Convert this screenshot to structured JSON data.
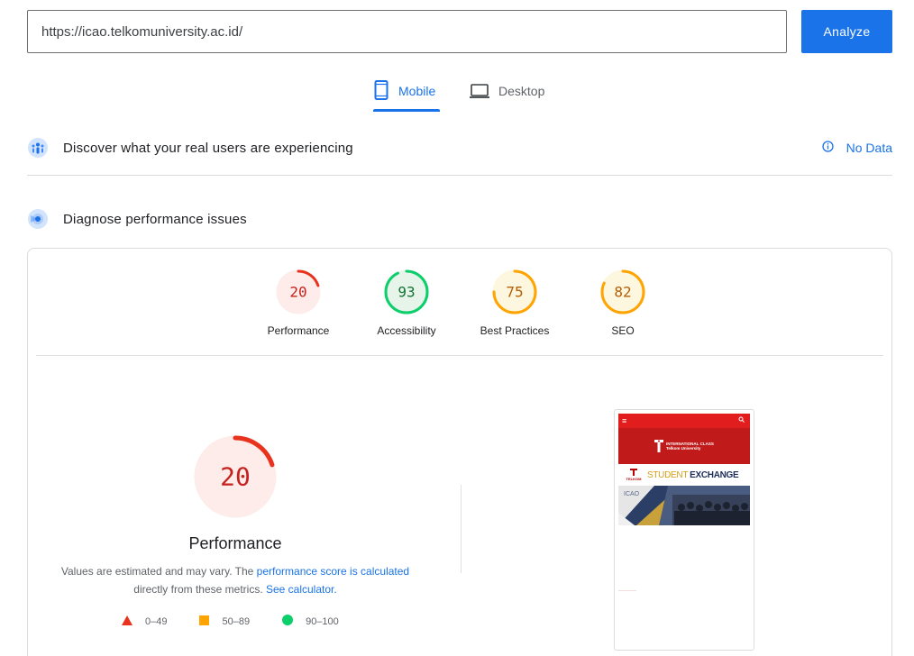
{
  "search": {
    "url": "https://icao.telkomuniversity.ac.id/",
    "analyze_label": "Analyze"
  },
  "tabs": [
    {
      "label": "Mobile",
      "active": true,
      "icon": "smartphone-icon"
    },
    {
      "label": "Desktop",
      "active": false,
      "icon": "laptop-icon"
    }
  ],
  "field_data": {
    "title": "Discover what your real users are experiencing",
    "status": "No Data",
    "icon": "users-icon",
    "status_icon": "info-icon"
  },
  "diagnose": {
    "title": "Diagnose performance issues",
    "icon": "lighthouse-icon"
  },
  "scores": [
    {
      "label": "Performance",
      "value": "20",
      "fraction": 0.2,
      "color": "#e8321e",
      "bg": "#fdecea",
      "text": "#c5221f"
    },
    {
      "label": "Accessibility",
      "value": "93",
      "fraction": 0.93,
      "color": "#0cce6b",
      "bg": "#e6f4ea",
      "text": "#137333"
    },
    {
      "label": "Best Practices",
      "value": "75",
      "fraction": 0.75,
      "color": "#ffa400",
      "bg": "#fef7e0",
      "text": "#b45f06"
    },
    {
      "label": "SEO",
      "value": "82",
      "fraction": 0.82,
      "color": "#ffa400",
      "bg": "#fef7e0",
      "text": "#b45f06"
    }
  ],
  "performance_detail": {
    "value": "20",
    "fraction": 0.2,
    "title": "Performance",
    "note_prefix": "Values are estimated and may vary. The ",
    "note_link1": "performance score is calculated",
    "note_mid": " directly from these metrics. ",
    "note_link2": "See calculator."
  },
  "legend": [
    {
      "range": "0–49",
      "shape": "triangle",
      "color": "#e8321e"
    },
    {
      "range": "50–89",
      "shape": "square",
      "color": "#ffa400"
    },
    {
      "range": "90–100",
      "shape": "circle",
      "color": "#0cce6b"
    }
  ],
  "screenshot": {
    "brand_line1": "INTERNATIONAL CLASS",
    "brand_line2": "Telkom University",
    "tel_label": "TELKOM",
    "student": "STUDENT",
    "exchange": "EXCHANGE",
    "icao": "ICAO",
    "nav_color": "#e21d1d",
    "banner_color": "#c01a1a"
  }
}
